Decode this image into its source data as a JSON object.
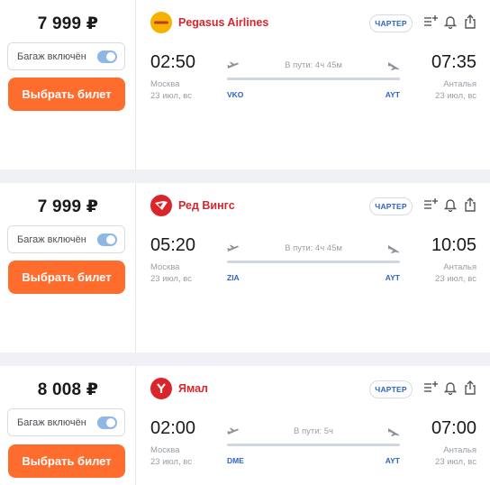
{
  "colors": {
    "accent": "#ff6d2e",
    "airline_text": "#d8262e",
    "link_blue": "#2e64c8"
  },
  "flights": [
    {
      "price": "7 999 ₽",
      "baggage_label": "Багаж включён",
      "baggage_enabled": true,
      "buy_label": "Выбрать билет",
      "airline": "Pegasus Airlines",
      "airline_logo": "pegasus-logo",
      "badge": "ЧАРТЕР",
      "dep_time": "02:50",
      "arr_time": "07:35",
      "duration": "В пути: 4ч 45м",
      "dep_city": "Москва",
      "arr_city": "Анталья",
      "dep_date": "23 июл, вс",
      "arr_date": "23 июл, вс",
      "dep_code": "VKO",
      "arr_code": "AYT"
    },
    {
      "price": "7 999 ₽",
      "baggage_label": "Багаж включён",
      "baggage_enabled": true,
      "buy_label": "Выбрать билет",
      "airline": "Ред Вингс",
      "airline_logo": "red-wings-logo",
      "badge": "ЧАРТЕР",
      "dep_time": "05:20",
      "arr_time": "10:05",
      "duration": "В пути: 4ч 45м",
      "dep_city": "Москва",
      "arr_city": "Анталья",
      "dep_date": "23 июл, вс",
      "arr_date": "23 июл, вс",
      "dep_code": "ZIA",
      "arr_code": "AYT"
    },
    {
      "price": "8 008 ₽",
      "baggage_label": "Багаж включён",
      "baggage_enabled": true,
      "buy_label": "Выбрать билет",
      "airline": "Ямал",
      "airline_logo": "yamal-logo",
      "badge": "ЧАРТЕР",
      "dep_time": "02:00",
      "arr_time": "07:00",
      "duration": "В пути: 5ч",
      "dep_city": "Москва",
      "arr_city": "Анталья",
      "dep_date": "23 июл, вс",
      "arr_date": "23 июл, вс",
      "dep_code": "DME",
      "arr_code": "AYT"
    }
  ],
  "icons": [
    "add-to-list-icon",
    "bell-icon",
    "share-icon",
    "takeoff-icon",
    "landing-icon"
  ]
}
